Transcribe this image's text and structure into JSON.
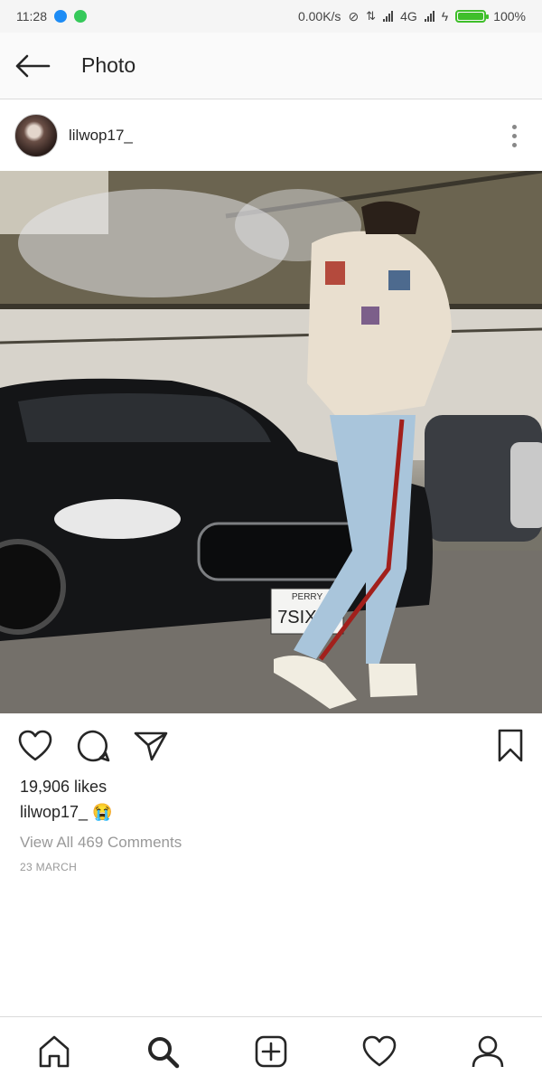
{
  "status_bar": {
    "time": "11:28",
    "network_speed": "0.00K/s",
    "network_type": "4G",
    "battery": "100%",
    "battery_level": 1.0,
    "notification_icons": [
      "messenger-icon",
      "whatsapp-icon"
    ]
  },
  "header": {
    "title": "Photo",
    "back_icon": "arrow-left-icon"
  },
  "post": {
    "username": "lilwop17_",
    "likes": "19,906 likes",
    "caption": "lilwop17_ 😭",
    "view_comments": "View All 469 Comments",
    "date": "23 MARCH",
    "plate_text": "7SIX39",
    "plate_brand": "PERRY"
  },
  "actions": [
    "heart-icon",
    "comment-icon",
    "send-icon",
    "bookmark-icon"
  ],
  "bottom_nav": [
    "home-icon",
    "search-icon",
    "add-post-icon",
    "activity-heart-icon",
    "profile-icon"
  ],
  "colors": {
    "messenger": "#1d8cf5",
    "whatsapp": "#36c95a",
    "battery": "#3fbf2a",
    "text": "#262626",
    "muted": "#999999"
  }
}
